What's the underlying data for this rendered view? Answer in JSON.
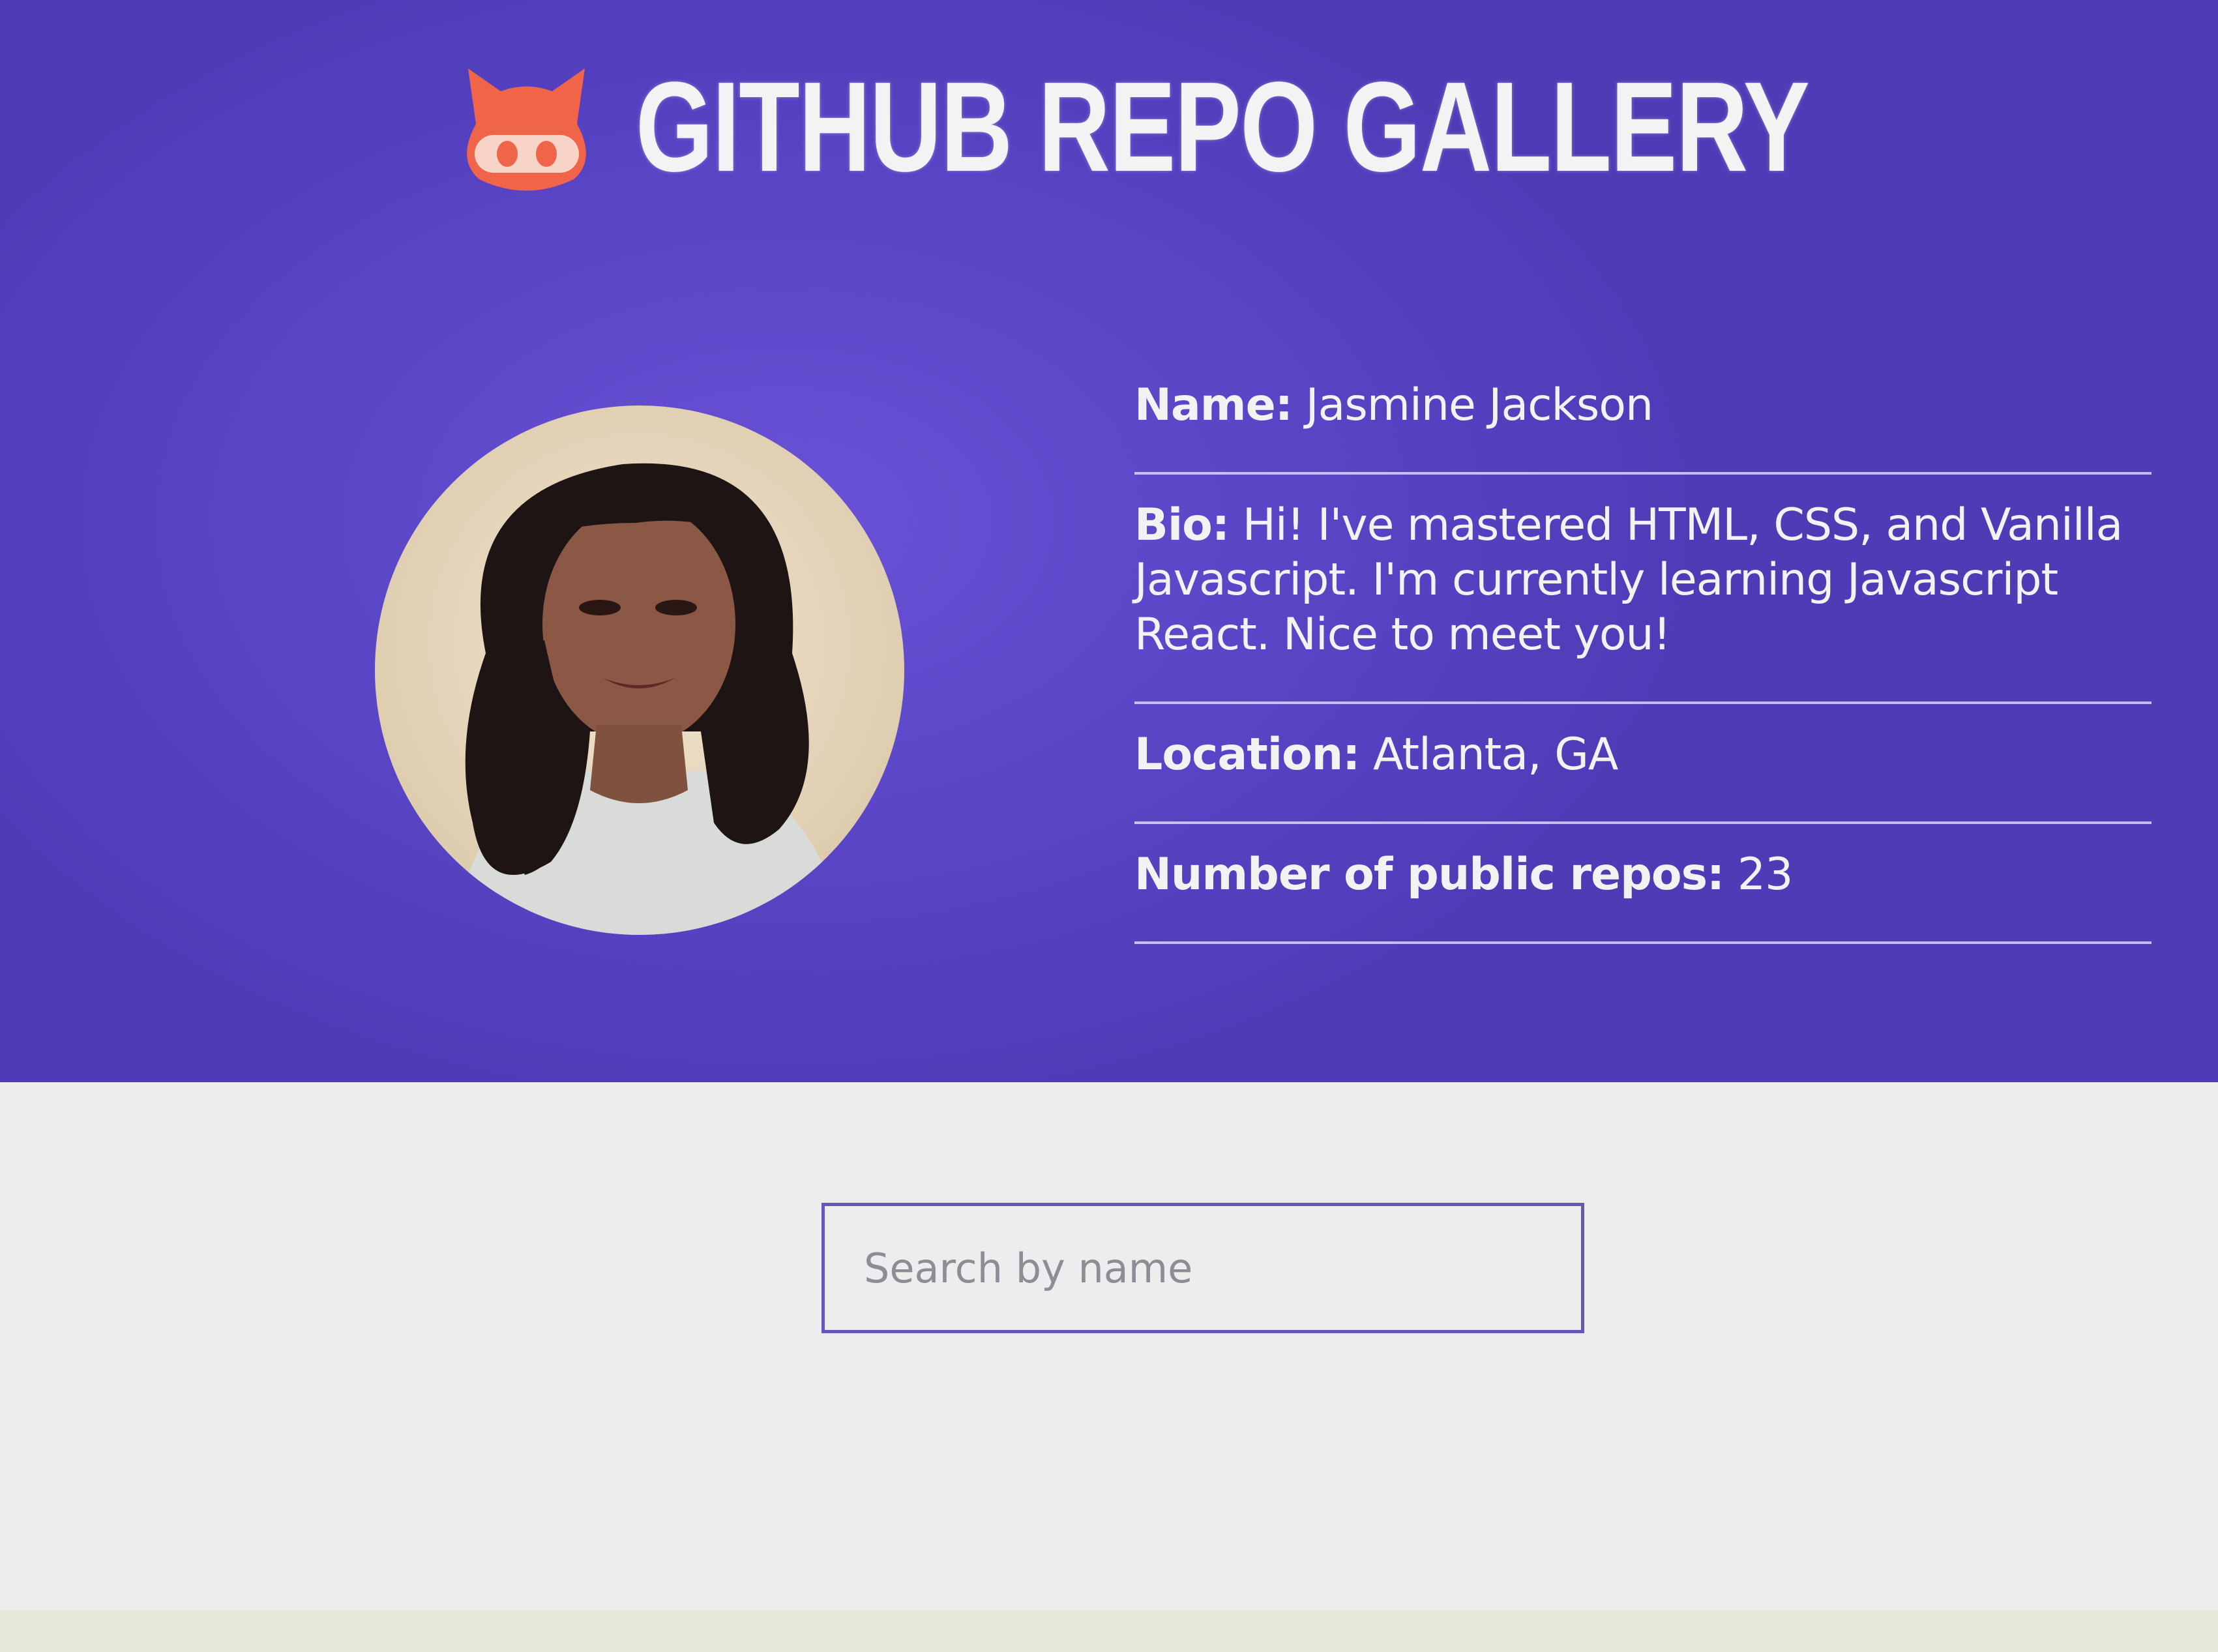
{
  "header": {
    "logo_icon": "github-octocat-icon",
    "title": "GITHUB REPO GALLERY"
  },
  "profile": {
    "avatar": "user-avatar-photo",
    "name_label": "Name:",
    "name_value": "Jasmine Jackson",
    "bio_label": "Bio:",
    "bio_value": "Hi! I've mastered HTML, CSS, and Vanilla Javascript. I'm currently learning Javascript React. Nice to meet you!",
    "location_label": "Location:",
    "location_value": "Atlanta, GA",
    "repos_label": "Number of public repos:",
    "repos_value": "23"
  },
  "search": {
    "placeholder": "Search by name",
    "value": ""
  },
  "colors": {
    "hero_background": "#5a45c6",
    "logo_accent": "#f0654a",
    "search_border": "#6656b8",
    "page_background": "#eceeee"
  }
}
